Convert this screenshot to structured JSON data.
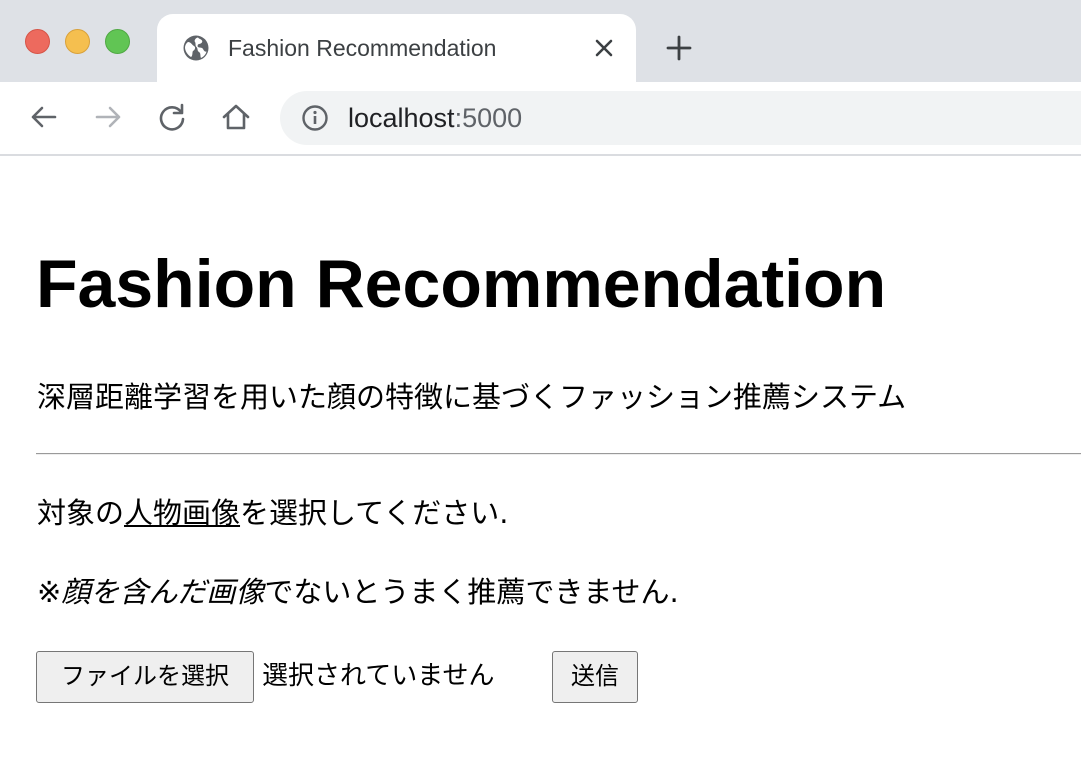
{
  "browser": {
    "tab": {
      "title": "Fashion Recommendation",
      "icon": "globe-icon"
    },
    "address": {
      "host": "localhost",
      "port": ":5000"
    },
    "colors": {
      "tabstrip": "#dee1e6",
      "omnibox": "#f1f3f4",
      "close": "#ed6a5e",
      "minimize": "#f5bf4f",
      "maximize": "#61c554"
    }
  },
  "page": {
    "title": "Fashion Recommendation",
    "subtitle": "深層距離学習を用いた顔の特徴に基づくファッション推薦システム",
    "instruction": {
      "prefix": "対象の",
      "emphasis": "人物画像",
      "suffix": "を選択してください."
    },
    "note": {
      "prefix": "※",
      "emphasis": "顔を含んだ画像",
      "suffix": "でないとうまく推薦できません."
    },
    "form": {
      "file_button_label": "ファイルを選択",
      "file_status": "選択されていません",
      "submit_label": "送信"
    }
  }
}
